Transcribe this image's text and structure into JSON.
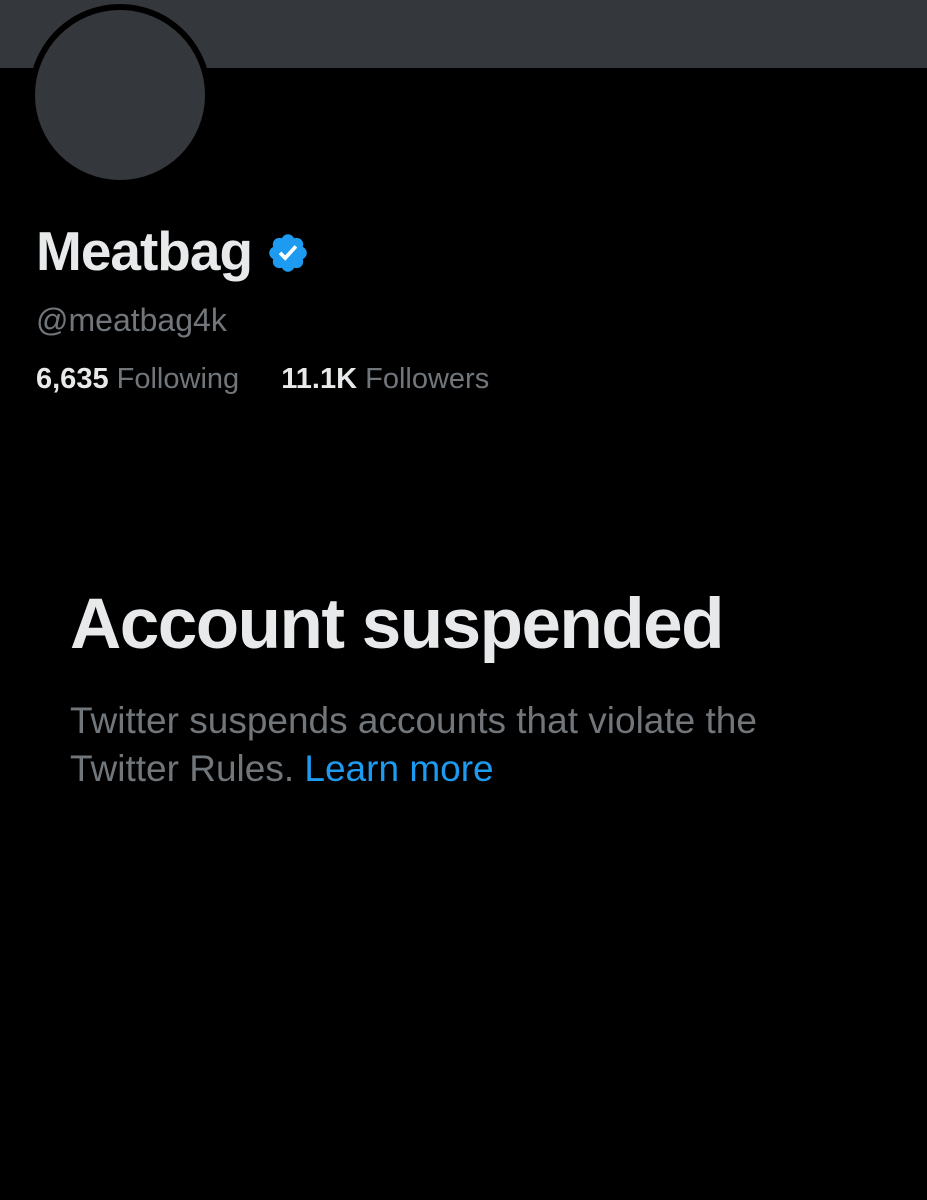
{
  "profile": {
    "display_name": "Meatbag",
    "handle": "@meatbag4k",
    "verified_icon": "verified-badge-icon",
    "following_count": "6,635",
    "following_label": "Following",
    "followers_count": "11.1K",
    "followers_label": "Followers"
  },
  "suspension": {
    "title": "Account suspended",
    "body": "Twitter suspends accounts that violate the Twitter Rules. ",
    "link_text": "Learn more"
  },
  "colors": {
    "background": "#000000",
    "banner": "#34373b",
    "primary_text": "#e7e9ea",
    "secondary_text": "#71767b",
    "accent": "#1d9bf0"
  }
}
